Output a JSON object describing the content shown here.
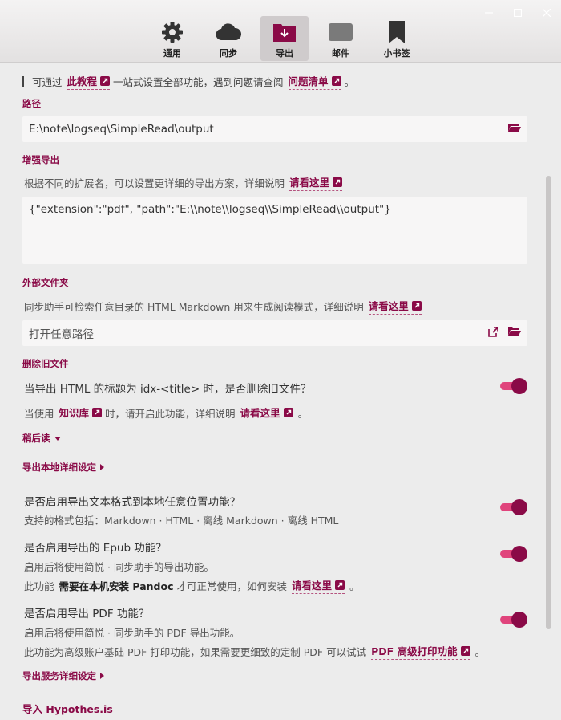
{
  "tabs": [
    {
      "label": "通用",
      "icon": "gear-icon"
    },
    {
      "label": "同步",
      "icon": "cloud-icon"
    },
    {
      "label": "导出",
      "icon": "folder-download-icon"
    },
    {
      "label": "邮件",
      "icon": "mail-icon"
    },
    {
      "label": "小书签",
      "icon": "bookmark-icon"
    }
  ],
  "active_tab": "导出",
  "intro": {
    "prefix": "可通过",
    "link1": "此教程",
    "middle": "一站式设置全部功能，遇到问题请查阅",
    "link2": "问题清单",
    "suffix": "。"
  },
  "path": {
    "title": "路径",
    "value": "E:\\note\\logseq\\SimpleRead\\output"
  },
  "enhanced": {
    "title": "增强导出",
    "desc": "根据不同的扩展名，可以设置更详细的导出方案，详细说明",
    "link": "请看这里",
    "value": "{\"extension\":\"pdf\", \"path\":\"E:\\\\note\\\\logseq\\\\SimpleRead\\\\output\"}"
  },
  "external": {
    "title": "外部文件夹",
    "desc": "同步助手可检索任意目录的 HTML Markdown 用来生成阅读模式，详细说明",
    "link": "请看这里",
    "placeholder": "打开任意路径"
  },
  "delete_old": {
    "title": "删除旧文件",
    "question": "当导出 HTML 的标题为 idx-<title> 时，是否删除旧文件？",
    "desc_prefix": "当使用",
    "desc_link1": "知识库",
    "desc_middle": "时，请开启此功能，详细说明",
    "desc_link2": "请看这里",
    "desc_suffix": "。",
    "enabled": true
  },
  "read_later": {
    "label": "稍后读"
  },
  "local_export": {
    "label": "导出本地详细设定"
  },
  "text_export": {
    "question": "是否启用导出文本格式到本地任意位置功能？",
    "desc": "支持的格式包括：Markdown · HTML · 离线 Markdown · 离线 HTML",
    "enabled": true
  },
  "epub_export": {
    "question": "是否启用导出的 Epub 功能？",
    "desc1": "启用后将使用简悦 · 同步助手的导出功能。",
    "desc2_prefix": "此功能",
    "desc2_strong": "需要在本机安装 Pandoc",
    "desc2_middle": "才可正常使用，如何安装",
    "desc2_link": "请看这里",
    "desc2_suffix": "。",
    "enabled": true
  },
  "pdf_export": {
    "question": "是否启用导出 PDF 功能？",
    "desc1": "启用后将使用简悦 · 同步助手的 PDF 导出功能。",
    "desc2": "此功能为高级账户基础 PDF 打印功能，如果需要更细致的定制 PDF 可以试试",
    "desc2_link": "PDF 高级打印功能",
    "desc2_suffix": "。",
    "enabled": true
  },
  "service_export": {
    "label": "导出服务详细设定"
  },
  "hypothesis": {
    "title": "导入 Hypothes.is"
  },
  "colors": {
    "accent": "#8a0a47",
    "toggle_track": "#e0447c"
  }
}
